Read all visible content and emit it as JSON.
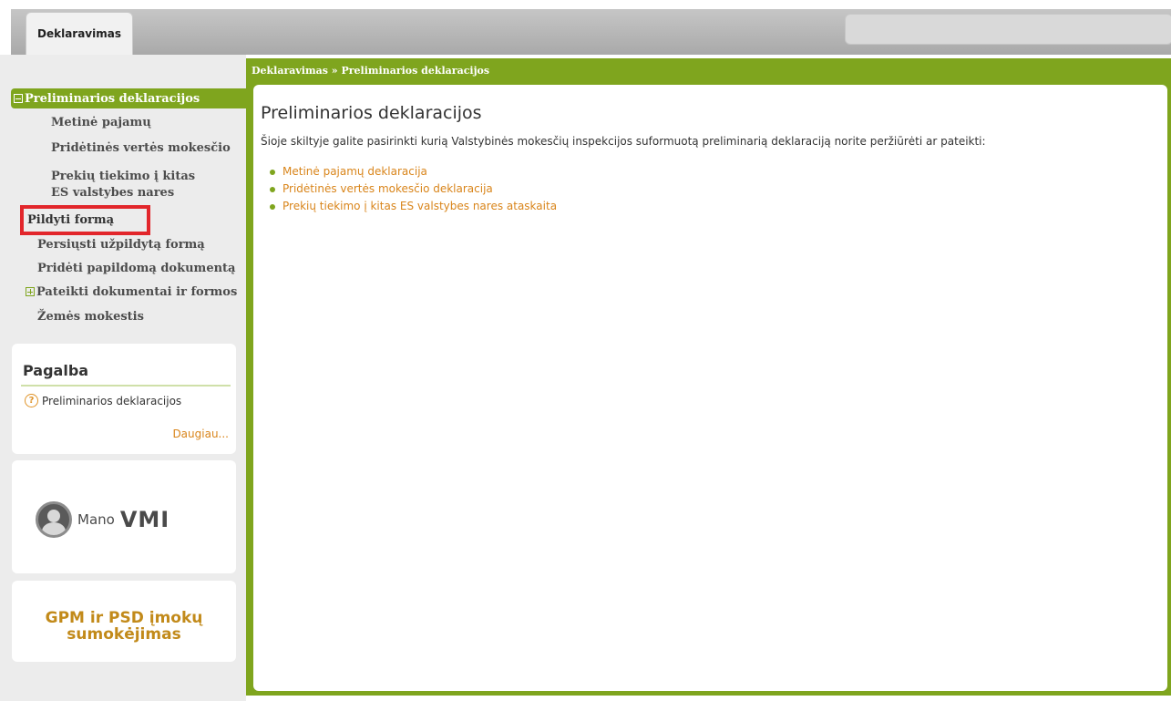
{
  "header": {
    "tab_label": "Deklaravimas"
  },
  "sidebar": {
    "active_item": "Preliminarios deklaracijos",
    "items": [
      "Metinė pajamų",
      "Pridėtinės vertės mokesčio",
      "Prekių tiekimo į kitas ES valstybes nares",
      "Pildyti formą",
      "Persiųsti užpildytą formą",
      "Pridėti papildomą dokumentą",
      "Pateikti dokumentai ir formos",
      "Žemės mokestis"
    ]
  },
  "help": {
    "title": "Pagalba",
    "link": "Preliminarios deklaracijos",
    "more": "Daugiau..."
  },
  "logo": {
    "mano": "Mano",
    "vmi": "VMI"
  },
  "gpm": {
    "line1": "GPM ir PSD įmokų",
    "line2": "sumokėjimas"
  },
  "main": {
    "breadcrumb": "Deklaravimas » Preliminarios deklaracijos",
    "title": "Preliminarios deklaracijos",
    "intro": "Šioje skiltyje galite pasirinkti kurią Valstybinės mokesčių inspekcijos suformuotą preliminarią deklaraciją norite peržiūrėti ar pateikti:",
    "links": [
      "Metinė pajamų deklaracija",
      "Pridėtinės vertės mokesčio deklaracija",
      "Prekių tiekimo į kitas ES valstybes nares ataskaita"
    ]
  },
  "colors": {
    "accent": "#7fa51e",
    "link": "#d9851b",
    "highlight": "#e2262b"
  }
}
